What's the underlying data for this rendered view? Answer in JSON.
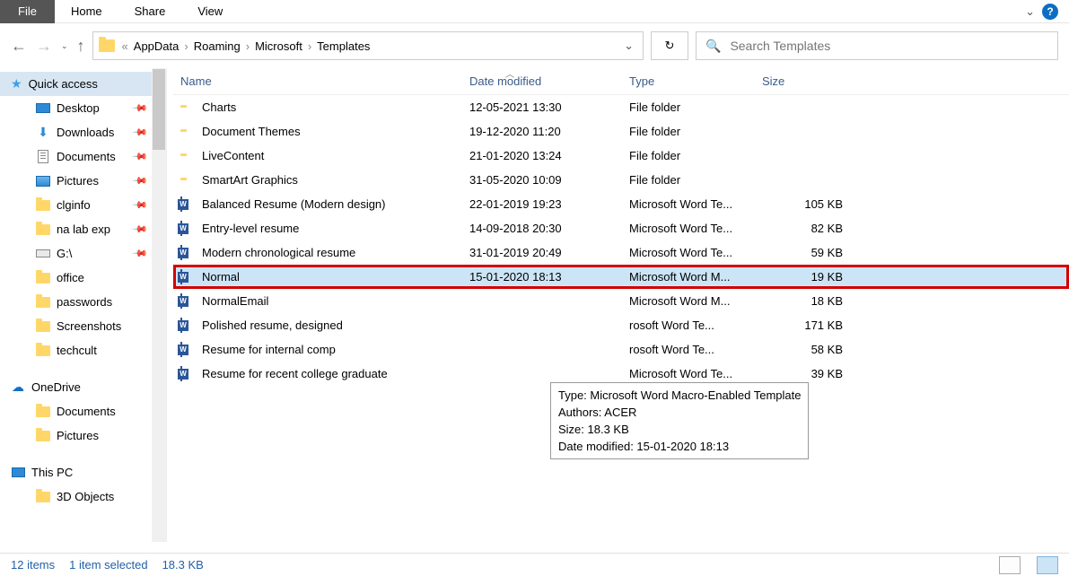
{
  "ribbon": {
    "file": "File",
    "home": "Home",
    "share": "Share",
    "view": "View",
    "help": "?"
  },
  "breadcrumb": {
    "pre": "«",
    "sep": "›",
    "items": [
      "AppData",
      "Roaming",
      "Microsoft",
      "Templates"
    ]
  },
  "search": {
    "placeholder": "Search Templates"
  },
  "navpane": {
    "quick_access": "Quick access",
    "quick_items": [
      {
        "label": "Desktop",
        "pin": true,
        "icon": "desktop"
      },
      {
        "label": "Downloads",
        "pin": true,
        "icon": "download"
      },
      {
        "label": "Documents",
        "pin": true,
        "icon": "doc"
      },
      {
        "label": "Pictures",
        "pin": true,
        "icon": "pic"
      },
      {
        "label": "clginfo",
        "pin": true,
        "icon": "fld"
      },
      {
        "label": "na lab exp",
        "pin": true,
        "icon": "fld"
      },
      {
        "label": "G:\\",
        "pin": true,
        "icon": "drive"
      },
      {
        "label": "office",
        "pin": false,
        "icon": "fld"
      },
      {
        "label": "passwords",
        "pin": false,
        "icon": "fld"
      },
      {
        "label": "Screenshots",
        "pin": false,
        "icon": "fld"
      },
      {
        "label": "techcult",
        "pin": false,
        "icon": "fld"
      }
    ],
    "onedrive": "OneDrive",
    "onedrive_items": [
      {
        "label": "Documents",
        "icon": "fld"
      },
      {
        "label": "Pictures",
        "icon": "fld"
      }
    ],
    "this_pc": "This PC",
    "this_pc_items": [
      {
        "label": "3D Objects",
        "icon": "fld"
      }
    ]
  },
  "columns": {
    "name": "Name",
    "date": "Date modified",
    "type": "Type",
    "size": "Size"
  },
  "rows": [
    {
      "icon": "fld",
      "name": "Charts",
      "date": "12-05-2021 13:30",
      "type": "File folder",
      "size": ""
    },
    {
      "icon": "fld",
      "name": "Document Themes",
      "date": "19-12-2020 11:20",
      "type": "File folder",
      "size": ""
    },
    {
      "icon": "fld",
      "name": "LiveContent",
      "date": "21-01-2020 13:24",
      "type": "File folder",
      "size": ""
    },
    {
      "icon": "fld",
      "name": "SmartArt Graphics",
      "date": "31-05-2020 10:09",
      "type": "File folder",
      "size": ""
    },
    {
      "icon": "word",
      "name": "Balanced Resume (Modern design)",
      "date": "22-01-2019 19:23",
      "type": "Microsoft Word Te...",
      "size": "105 KB"
    },
    {
      "icon": "word",
      "name": "Entry-level resume",
      "date": "14-09-2018 20:30",
      "type": "Microsoft Word Te...",
      "size": "82 KB"
    },
    {
      "icon": "word",
      "name": "Modern chronological resume",
      "date": "31-01-2019 20:49",
      "type": "Microsoft Word Te...",
      "size": "59 KB"
    },
    {
      "icon": "word",
      "name": "Normal",
      "date": "15-01-2020 18:13",
      "type": "Microsoft Word M...",
      "size": "19 KB",
      "selected": true,
      "highlight": true
    },
    {
      "icon": "word",
      "name": "NormalEmail",
      "date": "",
      "type": "Microsoft Word M...",
      "size": "18 KB"
    },
    {
      "icon": "word",
      "name": "Polished resume, designed",
      "date": "",
      "type": "rosoft Word Te...",
      "size": "171 KB"
    },
    {
      "icon": "word",
      "name": "Resume for internal comp",
      "date": "",
      "type": "rosoft Word Te...",
      "size": "58 KB"
    },
    {
      "icon": "word",
      "name": "Resume for recent college graduate",
      "date": "",
      "type": "Microsoft Word Te...",
      "size": "39 KB"
    }
  ],
  "tooltip": {
    "l1": "Type: Microsoft Word Macro-Enabled Template",
    "l2": "Authors: ACER",
    "l3": "Size: 18.3 KB",
    "l4": "Date modified: 15-01-2020 18:13"
  },
  "status": {
    "count": "12 items",
    "selected": "1 item selected",
    "size": "18.3 KB"
  }
}
